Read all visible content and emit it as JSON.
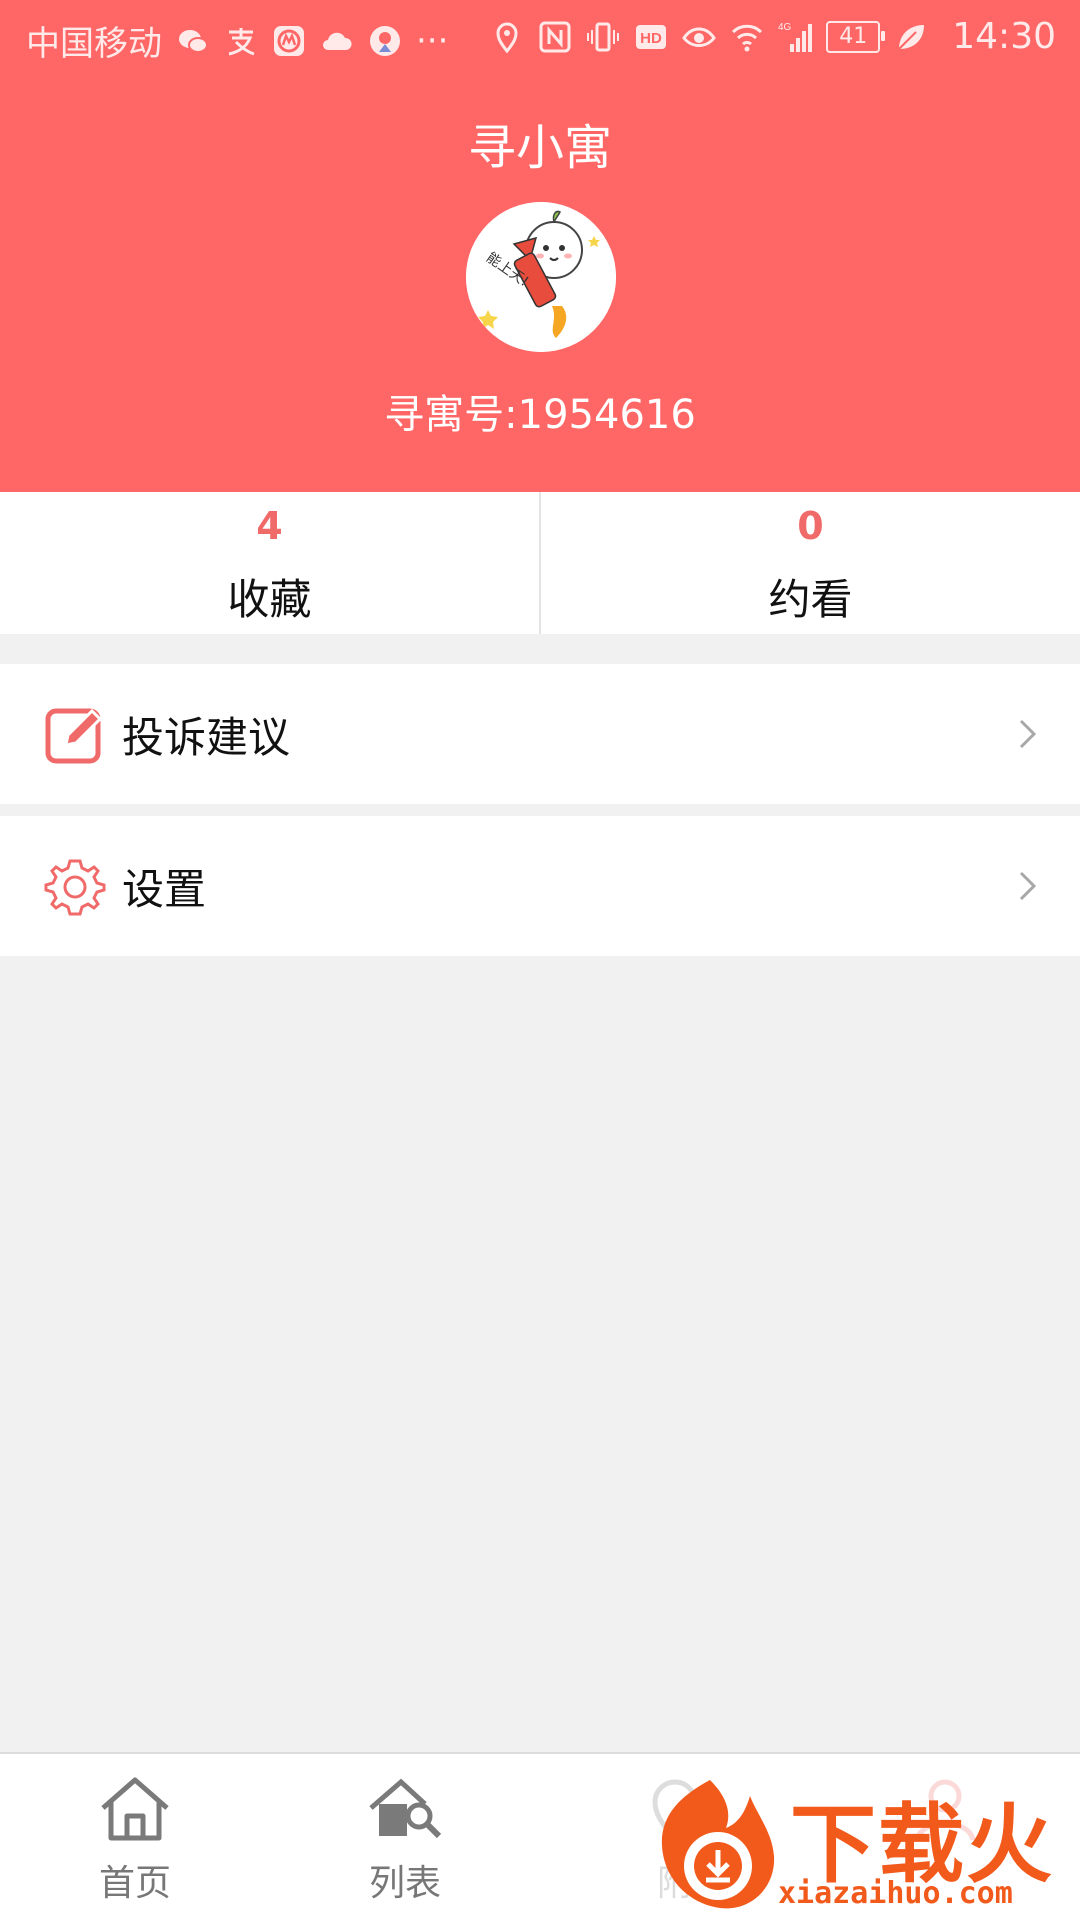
{
  "status_bar": {
    "carrier": "中国移动",
    "more": "···",
    "network": "4G",
    "battery": "41",
    "time": "14:30"
  },
  "header": {
    "title": "寻小寓",
    "account_id": "寻寓号:1954616",
    "avatar_caption": "能上天!"
  },
  "stats": [
    {
      "count": "4",
      "label": "收藏"
    },
    {
      "count": "0",
      "label": "约看"
    }
  ],
  "menu": [
    {
      "label": "投诉建议",
      "icon": "edit-icon"
    },
    {
      "label": "设置",
      "icon": "gear-icon"
    }
  ],
  "tabbar": [
    {
      "label": "首页",
      "icon": "home-icon"
    },
    {
      "label": "列表",
      "icon": "house-search-icon"
    },
    {
      "label": "附",
      "icon": "location-icon"
    },
    {
      "label": "",
      "icon": "user-icon"
    }
  ],
  "watermark": {
    "brand": "下载火",
    "url": "xiazaihuo.com"
  },
  "colors": {
    "header_bg": "#ff6767",
    "accent": "#f06a6a",
    "page_bg": "#f1f1f1",
    "watermark": "#f25a1c"
  }
}
